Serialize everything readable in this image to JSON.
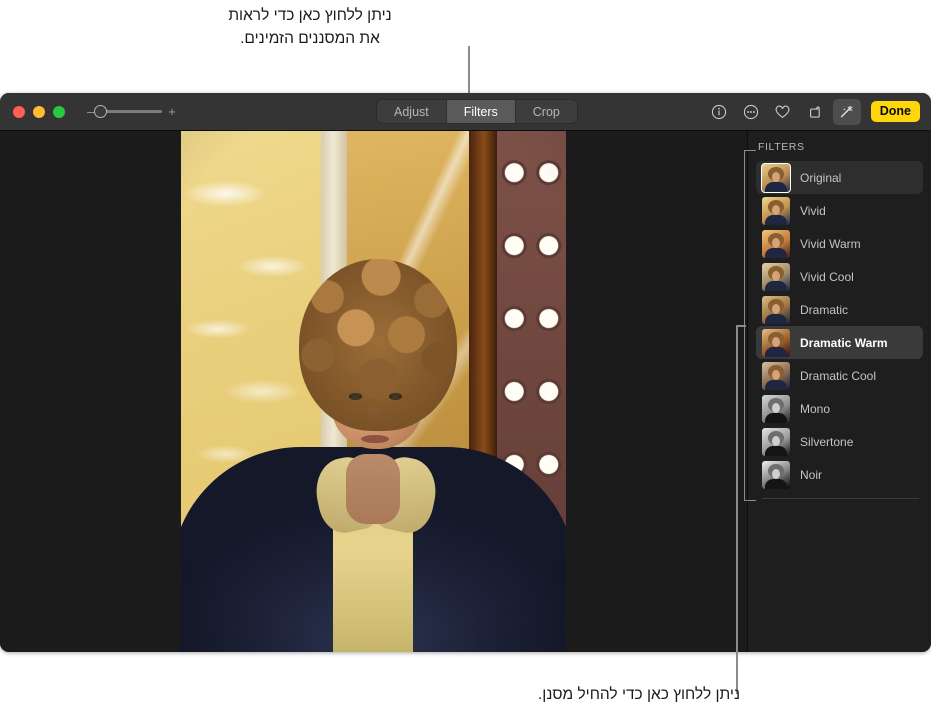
{
  "callouts": {
    "top": "ניתן ללחוץ כאן כדי לראות\nאת המסננים הזמינים.",
    "bottom": "ניתן ללחוץ כאן כדי להחיל מסנן."
  },
  "window": {
    "traffic_lights": [
      {
        "name": "close",
        "color": "#ff5f57"
      },
      {
        "name": "minimize",
        "color": "#febc2e"
      },
      {
        "name": "zoom",
        "color": "#28c840"
      }
    ],
    "zoom_slider": {
      "minus_label": "–",
      "plus_label": "+",
      "value": 0
    },
    "segmented_control": {
      "options": [
        "Adjust",
        "Filters",
        "Crop"
      ],
      "selected": "Filters"
    },
    "tool_icons": [
      {
        "name": "info-icon",
        "selected": false
      },
      {
        "name": "more-options-icon",
        "selected": false
      },
      {
        "name": "favorite-heart-icon",
        "selected": false
      },
      {
        "name": "rotate-icon",
        "selected": false
      },
      {
        "name": "auto-enhance-wand-icon",
        "selected": true
      }
    ],
    "done_label": "Done"
  },
  "sidebar": {
    "title": "FILTERS",
    "filters": [
      {
        "label": "Original",
        "selected": false,
        "hovered": true,
        "ring": true,
        "thumb": "linear-gradient(150deg,#e8d08a,#b98b52 55%,#26304c)"
      },
      {
        "label": "Vivid",
        "selected": false,
        "hovered": false,
        "ring": false,
        "thumb": "linear-gradient(150deg,#f0d98e,#c08f4e 55%,#1d2a4f)"
      },
      {
        "label": "Vivid Warm",
        "selected": false,
        "hovered": false,
        "ring": false,
        "thumb": "linear-gradient(150deg,#f2c87a,#c57c3c 55%,#3a1f1e)"
      },
      {
        "label": "Vivid Cool",
        "selected": false,
        "hovered": false,
        "ring": false,
        "thumb": "linear-gradient(150deg,#e3d5a8,#9f8868 55%,#16264f)"
      },
      {
        "label": "Dramatic",
        "selected": false,
        "hovered": false,
        "ring": false,
        "thumb": "linear-gradient(150deg,#d9c189,#9c7342 55%,#1a2239)"
      },
      {
        "label": "Dramatic Warm",
        "selected": true,
        "hovered": false,
        "ring": false,
        "thumb": "linear-gradient(150deg,#e2c08a,#9e5c2c 55%,#2e140d)"
      },
      {
        "label": "Dramatic Cool",
        "selected": false,
        "hovered": false,
        "ring": false,
        "thumb": "linear-gradient(150deg,#d3c4a0,#8a6a52 55%,#101d3f)"
      },
      {
        "label": "Mono",
        "selected": false,
        "hovered": false,
        "ring": false,
        "thumb": "linear-gradient(150deg,#d8d8d8,#8f8f8f 55%,#1d1d1d)"
      },
      {
        "label": "Silvertone",
        "selected": false,
        "hovered": false,
        "ring": false,
        "thumb": "linear-gradient(150deg,#e4e4e4,#9a9a9a 55%,#121212)"
      },
      {
        "label": "Noir",
        "selected": false,
        "hovered": false,
        "ring": false,
        "thumb": "linear-gradient(150deg,#f2f2f2,#8a8a8a 50%,#050505)"
      }
    ]
  },
  "photo": {
    "description": "portrait-of-person-with-curly-hair"
  }
}
